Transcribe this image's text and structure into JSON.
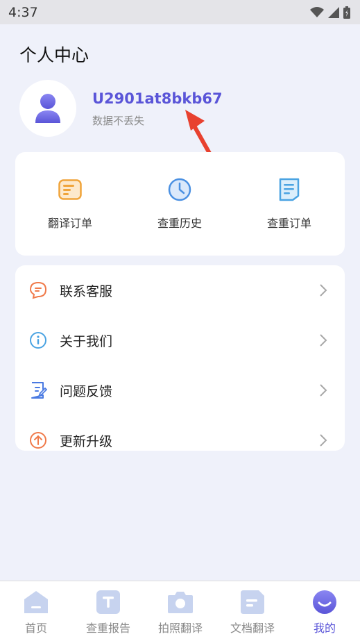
{
  "status_bar": {
    "time": "4:37"
  },
  "header": {
    "title": "个人中心"
  },
  "profile": {
    "user_id": "U2901at8bkb67",
    "subtitle": "数据不丢失"
  },
  "quick_actions": [
    {
      "label": "翻译订单",
      "icon": "translate-order-icon"
    },
    {
      "label": "查重历史",
      "icon": "clock-icon"
    },
    {
      "label": "查重订单",
      "icon": "document-icon"
    }
  ],
  "menu": [
    {
      "label": "联系客服",
      "icon": "chat-bubble-icon"
    },
    {
      "label": "关于我们",
      "icon": "info-icon"
    },
    {
      "label": "问题反馈",
      "icon": "edit-document-icon"
    },
    {
      "label": "更新升级",
      "icon": "upgrade-arrow-icon"
    }
  ],
  "tabbar": [
    {
      "label": "首页",
      "icon": "home-icon",
      "active": false
    },
    {
      "label": "查重报告",
      "icon": "report-t-icon",
      "active": false
    },
    {
      "label": "拍照翻译",
      "icon": "camera-icon",
      "active": false
    },
    {
      "label": "文档翻译",
      "icon": "doc-translate-icon",
      "active": false
    },
    {
      "label": "我的",
      "icon": "smile-face-icon",
      "active": true
    }
  ],
  "colors": {
    "accent": "#5a55d8",
    "orange": "#f0a43a",
    "blue": "#4a90e2",
    "red_arrow": "#e8412f",
    "background": "#eff1fa"
  }
}
